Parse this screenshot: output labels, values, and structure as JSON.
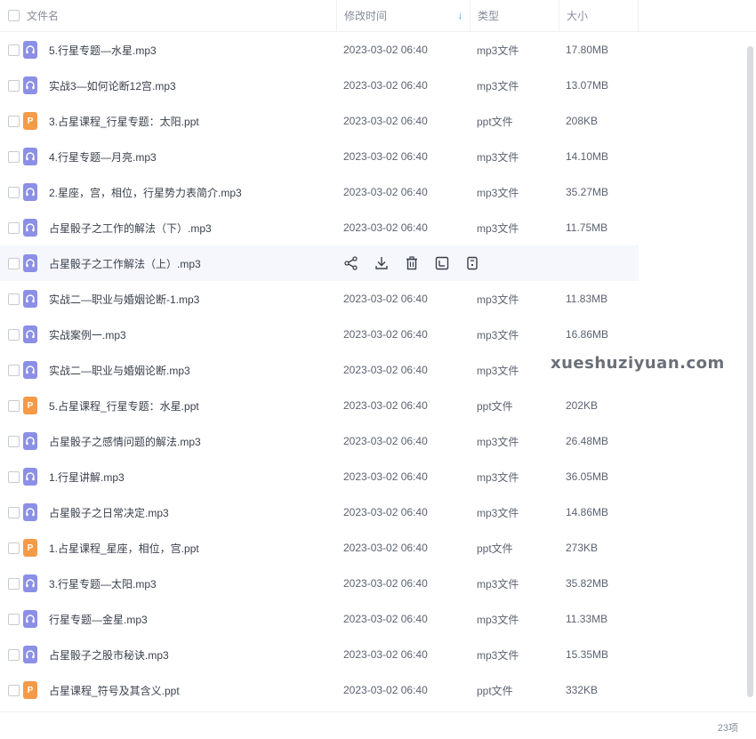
{
  "header": {
    "name": "文件名",
    "time": "修改时间",
    "type": "类型",
    "size": "大小",
    "sort_icon": "↓"
  },
  "files": [
    {
      "name": "5.行星专题—水星.mp3",
      "time": "2023-03-02 06:40",
      "type": "mp3文件",
      "size": "17.80MB",
      "icon": "mp3"
    },
    {
      "name": "实战3—如何论断12宫.mp3",
      "time": "2023-03-02 06:40",
      "type": "mp3文件",
      "size": "13.07MB",
      "icon": "mp3"
    },
    {
      "name": "3.占星课程_行星专题：太阳.ppt",
      "time": "2023-03-02 06:40",
      "type": "ppt文件",
      "size": "208KB",
      "icon": "ppt"
    },
    {
      "name": "4.行星专题—月亮.mp3",
      "time": "2023-03-02 06:40",
      "type": "mp3文件",
      "size": "14.10MB",
      "icon": "mp3"
    },
    {
      "name": "2.星座，宫，相位，行星势力表简介.mp3",
      "time": "2023-03-02 06:40",
      "type": "mp3文件",
      "size": "35.27MB",
      "icon": "mp3"
    },
    {
      "name": "占星骰子之工作的解法（下）.mp3",
      "time": "2023-03-02 06:40",
      "type": "mp3文件",
      "size": "11.75MB",
      "icon": "mp3"
    },
    {
      "name": "占星骰子之工作解法（上）.mp3",
      "time": "",
      "type": "",
      "size": "",
      "icon": "mp3",
      "hover": true
    },
    {
      "name": "实战二—职业与婚姻论断-1.mp3",
      "time": "2023-03-02 06:40",
      "type": "mp3文件",
      "size": "11.83MB",
      "icon": "mp3"
    },
    {
      "name": "实战案例一.mp3",
      "time": "2023-03-02 06:40",
      "type": "mp3文件",
      "size": "16.86MB",
      "icon": "mp3"
    },
    {
      "name": "实战二—职业与婚姻论断.mp3",
      "time": "2023-03-02 06:40",
      "type": "mp3文件",
      "size": "",
      "icon": "mp3"
    },
    {
      "name": "5.占星课程_行星专题：水星.ppt",
      "time": "2023-03-02 06:40",
      "type": "ppt文件",
      "size": "202KB",
      "icon": "ppt"
    },
    {
      "name": "占星骰子之感情问题的解法.mp3",
      "time": "2023-03-02 06:40",
      "type": "mp3文件",
      "size": "26.48MB",
      "icon": "mp3"
    },
    {
      "name": "1.行星讲解.mp3",
      "time": "2023-03-02 06:40",
      "type": "mp3文件",
      "size": "36.05MB",
      "icon": "mp3"
    },
    {
      "name": "占星骰子之日常决定.mp3",
      "time": "2023-03-02 06:40",
      "type": "mp3文件",
      "size": "14.86MB",
      "icon": "mp3"
    },
    {
      "name": "1.占星课程_星座，相位，宫.ppt",
      "time": "2023-03-02 06:40",
      "type": "ppt文件",
      "size": "273KB",
      "icon": "ppt"
    },
    {
      "name": "3.行星专题—太阳.mp3",
      "time": "2023-03-02 06:40",
      "type": "mp3文件",
      "size": "35.82MB",
      "icon": "mp3"
    },
    {
      "name": "行星专题—金星.mp3",
      "time": "2023-03-02 06:40",
      "type": "mp3文件",
      "size": "11.33MB",
      "icon": "mp3"
    },
    {
      "name": "占星骰子之股市秘诀.mp3",
      "time": "2023-03-02 06:40",
      "type": "mp3文件",
      "size": "15.35MB",
      "icon": "mp3"
    },
    {
      "name": "占星课程_符号及其含义.ppt",
      "time": "2023-03-02 06:40",
      "type": "ppt文件",
      "size": "332KB",
      "icon": "ppt"
    }
  ],
  "ppt_letter": "P",
  "actions": [
    "share-icon",
    "download-icon",
    "delete-icon",
    "rename-icon",
    "more-icon"
  ],
  "watermark": "xueshuziyuan.com",
  "footer": {
    "count": "23项"
  },
  "colors": {
    "mp3_icon": "#8b8fe6",
    "ppt_icon": "#f59a47",
    "accent": "#06a7ff",
    "hover_row": "#f5f7fc"
  }
}
